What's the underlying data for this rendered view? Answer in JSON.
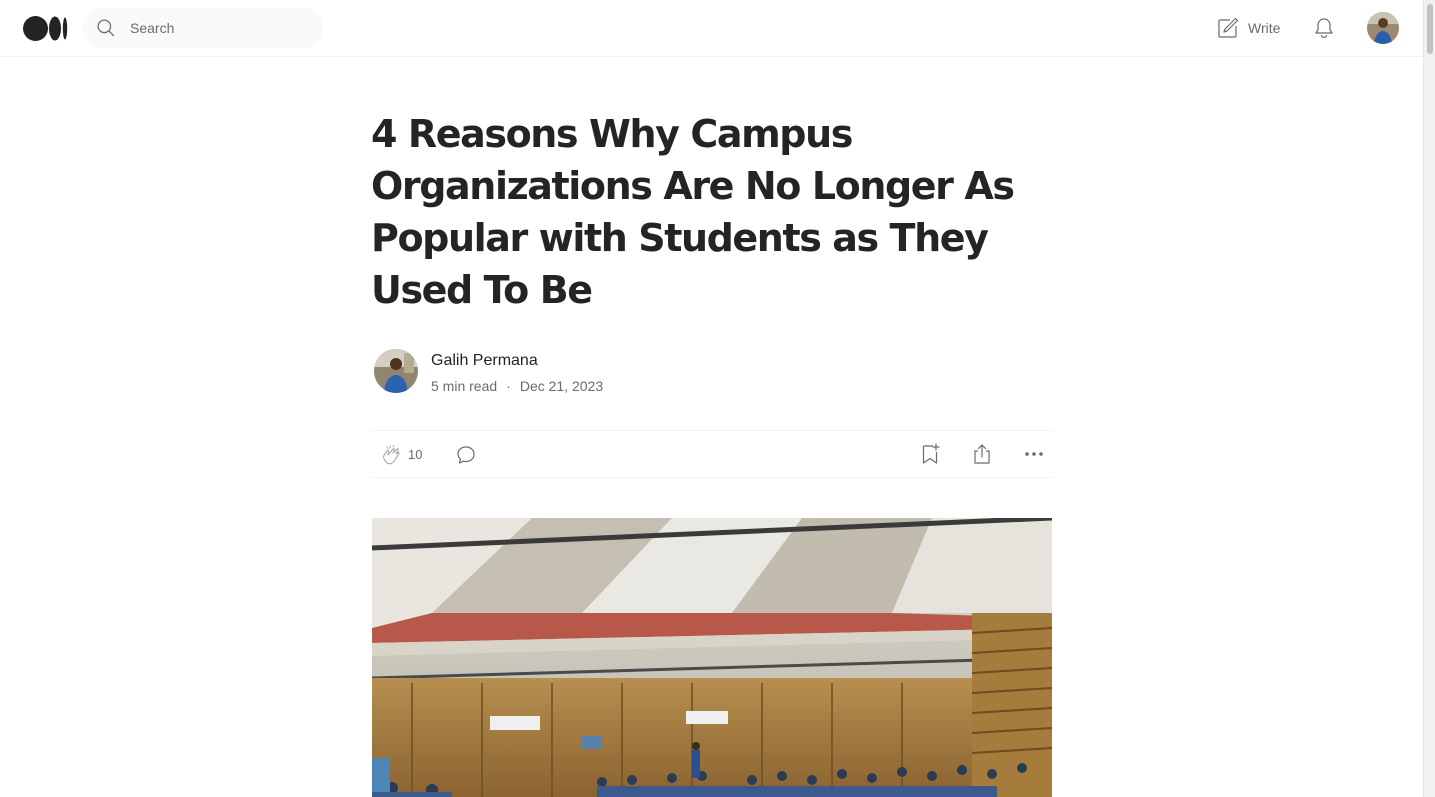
{
  "header": {
    "logo_name": "medium-logo",
    "search": {
      "placeholder": "Search"
    },
    "write_label": "Write"
  },
  "article": {
    "title": "4 Reasons Why Campus Organizations Are No Longer As Popular with Students as They Used To Be",
    "author": "Galih Permana",
    "read_time": "5 min read",
    "separator": "·",
    "date": "Dec 21, 2023"
  },
  "actions": {
    "clap_count": "10"
  },
  "colors": {
    "text": "#242424",
    "muted": "#6b6b6b",
    "divider": "#f2f2f2",
    "search_bg": "#f9f9f9"
  }
}
